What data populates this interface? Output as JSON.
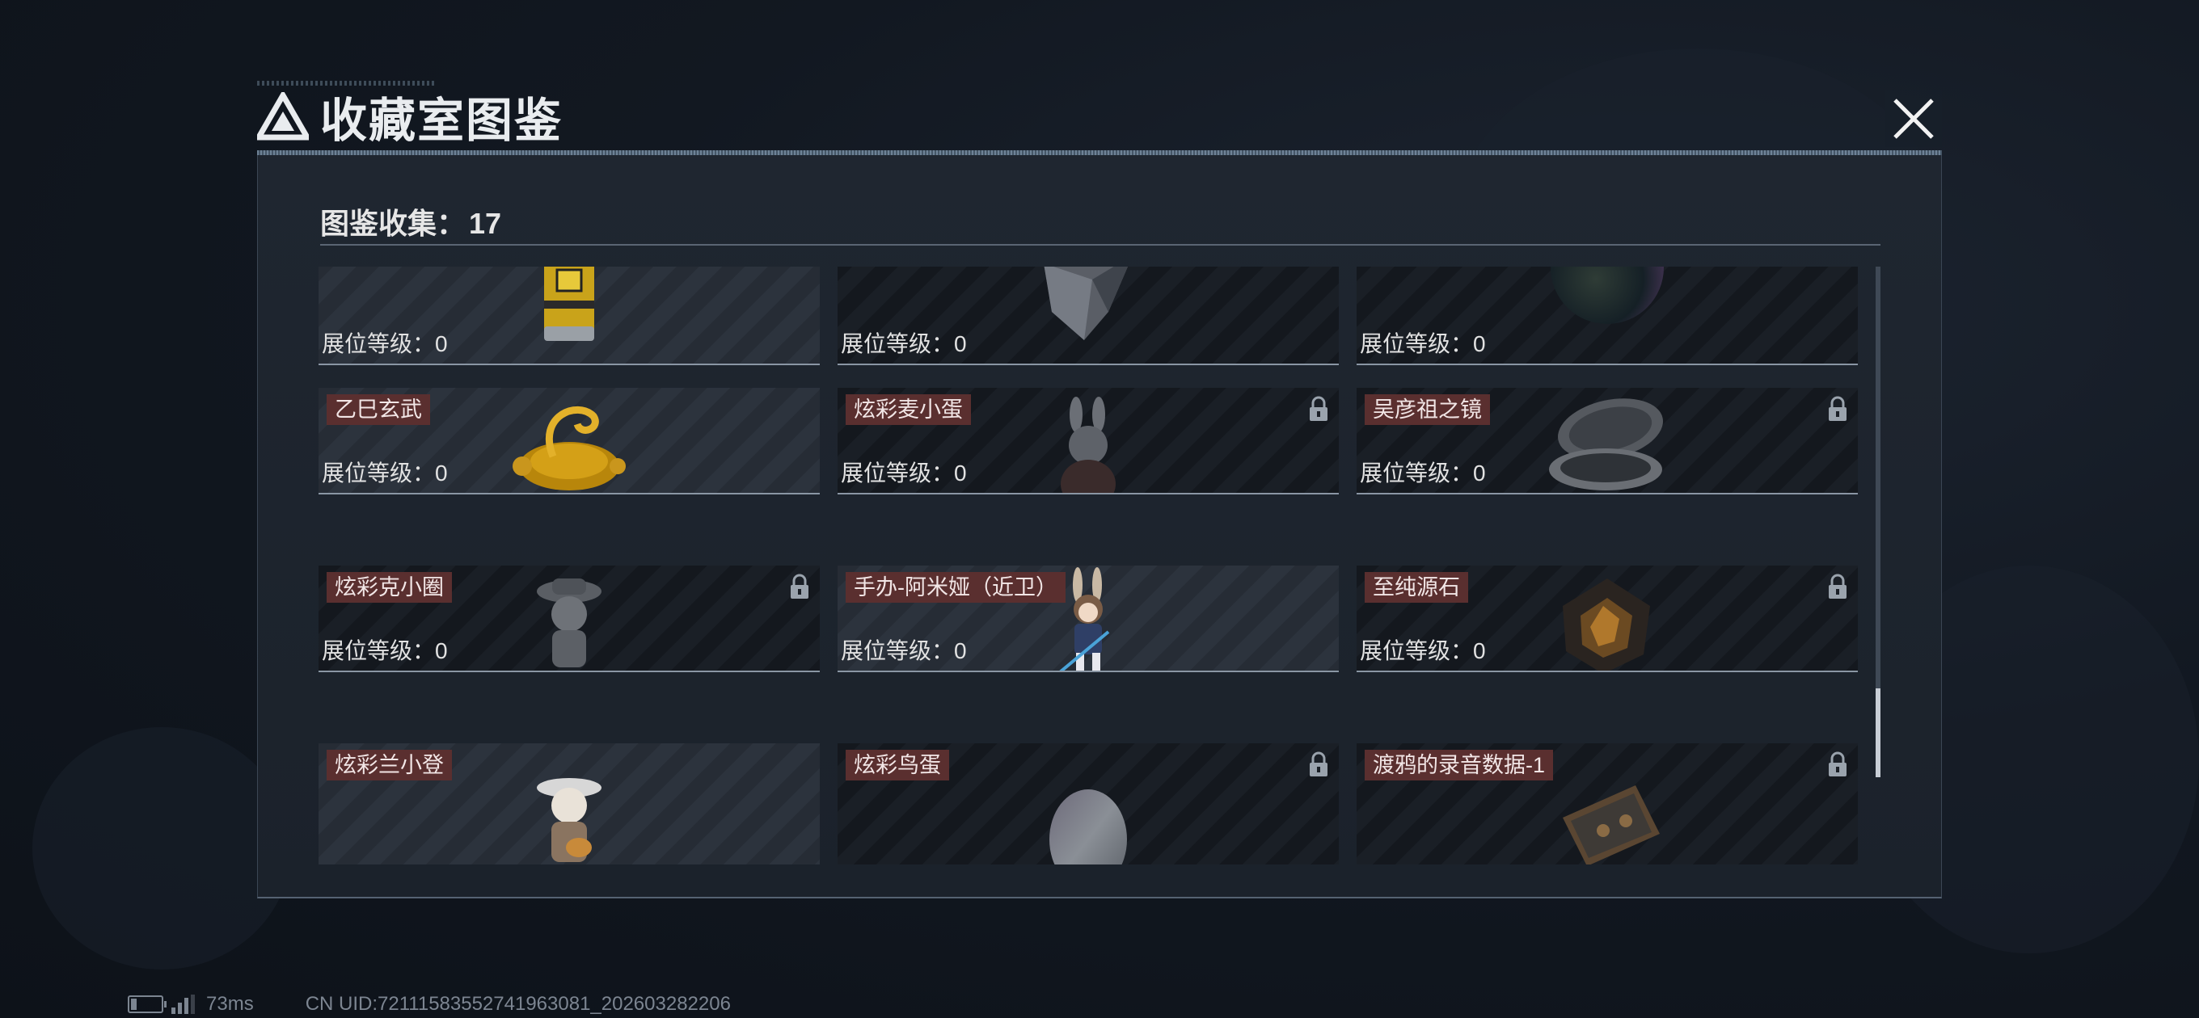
{
  "header": {
    "title": "收藏室图鉴",
    "logo_icon": "triangle-logo-icon",
    "close_icon": "close-icon"
  },
  "collection": {
    "label": "图鉴收集：",
    "count": "17"
  },
  "level_label": "展位等级：0",
  "cards": [
    {
      "name": "",
      "art_icon": "yellow-canister-icon",
      "locked": false
    },
    {
      "name": "",
      "art_icon": "crystal-shard-icon",
      "locked": false
    },
    {
      "name": "",
      "art_icon": "dark-orb-icon",
      "locked": false
    },
    {
      "name": "乙巳玄武",
      "art_icon": "golden-tortoise-snake-icon",
      "locked": false
    },
    {
      "name": "炫彩麦小蛋",
      "art_icon": "bunny-egg-figure-icon",
      "locked": true
    },
    {
      "name": "吴彦祖之镜",
      "art_icon": "compact-mirror-icon",
      "locked": true
    },
    {
      "name": "炫彩克小圈",
      "art_icon": "hat-figure-icon",
      "locked": true
    },
    {
      "name": "手办-阿米娅（近卫）",
      "art_icon": "amiya-figure-icon",
      "locked": false
    },
    {
      "name": "至纯源石",
      "art_icon": "originium-crystal-icon",
      "locked": true
    },
    {
      "name": "炫彩兰小登",
      "art_icon": "guitar-figure-icon",
      "locked": false
    },
    {
      "name": "炫彩鸟蛋",
      "art_icon": "iridescent-egg-icon",
      "locked": true
    },
    {
      "name": "渡鸦的录音数据-1",
      "art_icon": "cassette-tape-icon",
      "locked": true
    }
  ],
  "colors": {
    "name_tag": "#5a2f2f",
    "panel": "#1e252e",
    "accent_line": "#7d94aa"
  },
  "footer": {
    "battery_level": 0.2,
    "battery_icon": "battery-icon",
    "signal_icon": "signal-icon",
    "ping": "73ms",
    "uid": "CN UID:72111583552741963081_202603282206"
  }
}
